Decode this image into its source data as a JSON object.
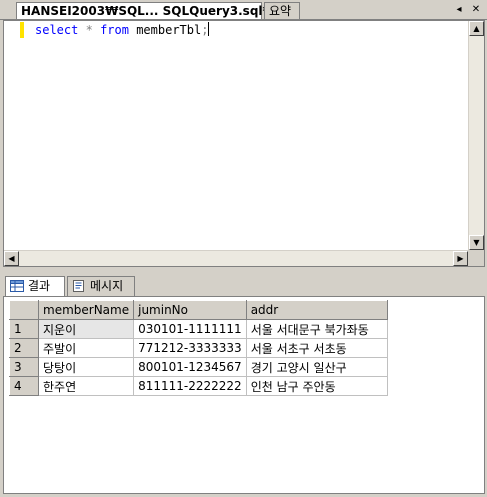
{
  "doc_tabs": [
    {
      "label": "HANSEI2003₩SQL... SQLQuery3.sql*"
    },
    {
      "label": "요약"
    }
  ],
  "controls": {
    "pin": "◂",
    "close": "✕"
  },
  "editor": {
    "keyword1": "select",
    "star": "*",
    "keyword2": "from",
    "table": "memberTbl",
    "semicolon": ";"
  },
  "result_tabs": [
    {
      "label": "결과",
      "icon": "grid-icon"
    },
    {
      "label": "메시지",
      "icon": "message-icon"
    }
  ],
  "grid": {
    "columns": [
      "memberName",
      "juminNo",
      "addr"
    ],
    "rows": [
      {
        "num": "1",
        "cells": [
          "지운이",
          "030101-1111111",
          "서울 서대문구 북가좌동"
        ]
      },
      {
        "num": "2",
        "cells": [
          "주발이",
          "771212-3333333",
          "서울 서초구 서초동"
        ]
      },
      {
        "num": "3",
        "cells": [
          "당탕이",
          "800101-1234567",
          "경기 고양시 일산구"
        ]
      },
      {
        "num": "4",
        "cells": [
          "한주연",
          "811111-2222222",
          "인천 남구 주안동"
        ]
      }
    ]
  }
}
